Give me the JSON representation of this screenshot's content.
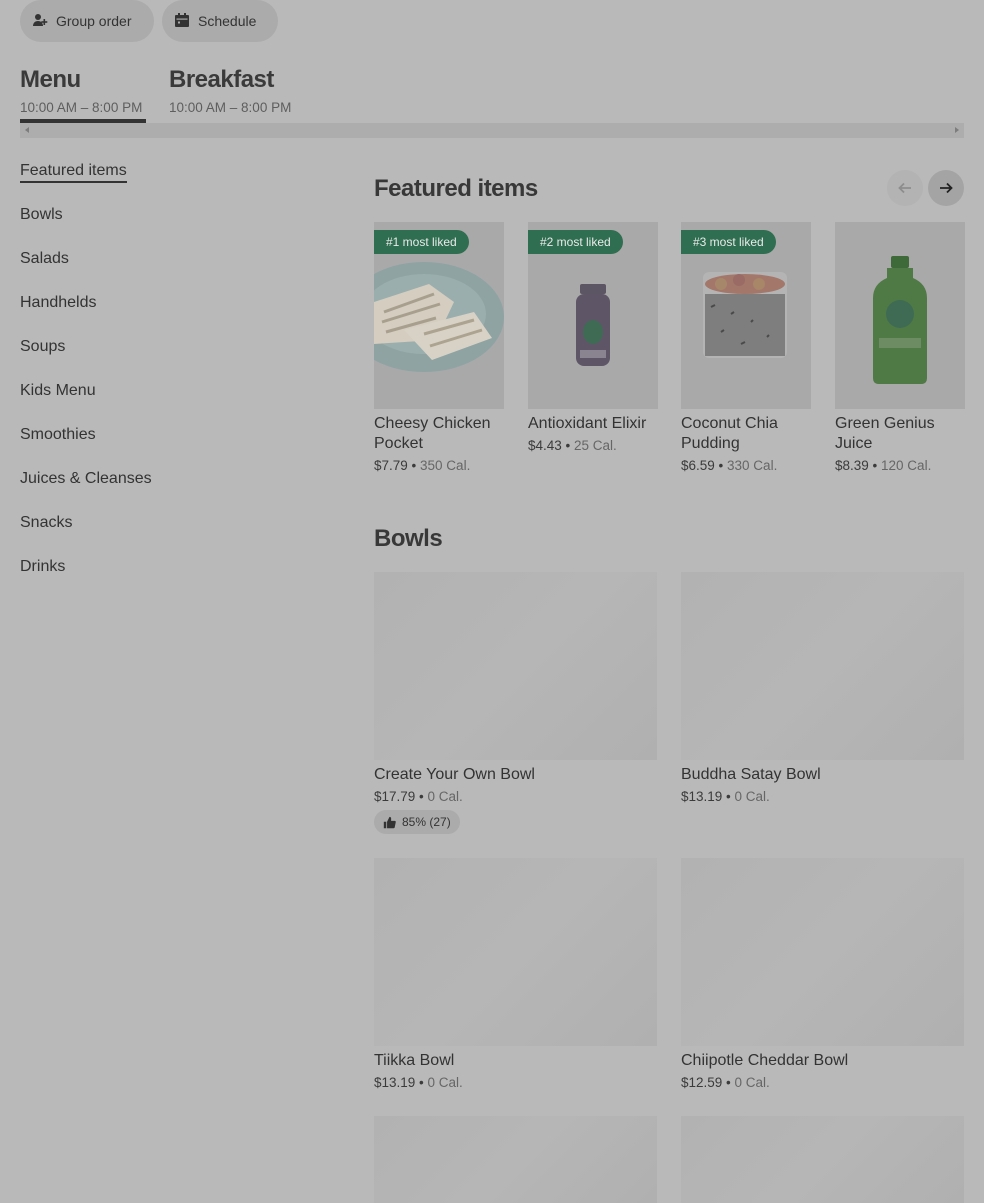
{
  "header": {
    "group_order": "Group order",
    "schedule": "Schedule"
  },
  "menus": [
    {
      "title": "Menu",
      "hours": "10:00 AM – 8:00 PM"
    },
    {
      "title": "Breakfast",
      "hours": "10:00 AM – 8:00 PM"
    }
  ],
  "sidebar": {
    "items": [
      {
        "label": "Featured items"
      },
      {
        "label": "Bowls"
      },
      {
        "label": "Salads"
      },
      {
        "label": "Handhelds"
      },
      {
        "label": "Soups"
      },
      {
        "label": "Kids Menu"
      },
      {
        "label": "Smoothies"
      },
      {
        "label": "Juices & Cleanses"
      },
      {
        "label": "Snacks"
      },
      {
        "label": "Drinks"
      }
    ]
  },
  "featured": {
    "title": "Featured items",
    "items": [
      {
        "badge": "#1 most liked",
        "name": "Cheesy Chicken Pocket",
        "price": "$7.79",
        "sep": " • ",
        "cal": "350 Cal."
      },
      {
        "badge": "#2 most liked",
        "name": "Antioxidant Elixir",
        "price": "$4.43",
        "sep": " • ",
        "cal": "25 Cal."
      },
      {
        "badge": "#3 most liked",
        "name": "Coconut Chia Pudding",
        "price": "$6.59",
        "sep": " • ",
        "cal": "330 Cal."
      },
      {
        "badge": "",
        "name": "Green Genius Juice",
        "price": "$8.39",
        "sep": " • ",
        "cal": "120 Cal."
      }
    ]
  },
  "bowls": {
    "title": "Bowls",
    "items": [
      {
        "name": "Create Your Own Bowl",
        "price": "$17.79",
        "sep": " • ",
        "cal": "0 Cal.",
        "rating": "85% (27)"
      },
      {
        "name": "Buddha Satay Bowl",
        "price": "$13.19",
        "sep": " • ",
        "cal": "0 Cal."
      },
      {
        "name": "Tiikka Bowl",
        "price": "$13.19",
        "sep": " • ",
        "cal": "0 Cal."
      },
      {
        "name": "Chiipotle Cheddar Bowl",
        "price": "$12.59",
        "sep": " • ",
        "cal": "0 Cal."
      }
    ]
  },
  "icons": {
    "group_order": "add-person-icon",
    "schedule": "calendar-icon",
    "prev": "arrow-left-icon",
    "next": "arrow-right-icon",
    "rating": "thumbs-up-icon"
  },
  "colors": {
    "badge": "#2f6e50",
    "overlay_bg": "#b9b9b9"
  }
}
